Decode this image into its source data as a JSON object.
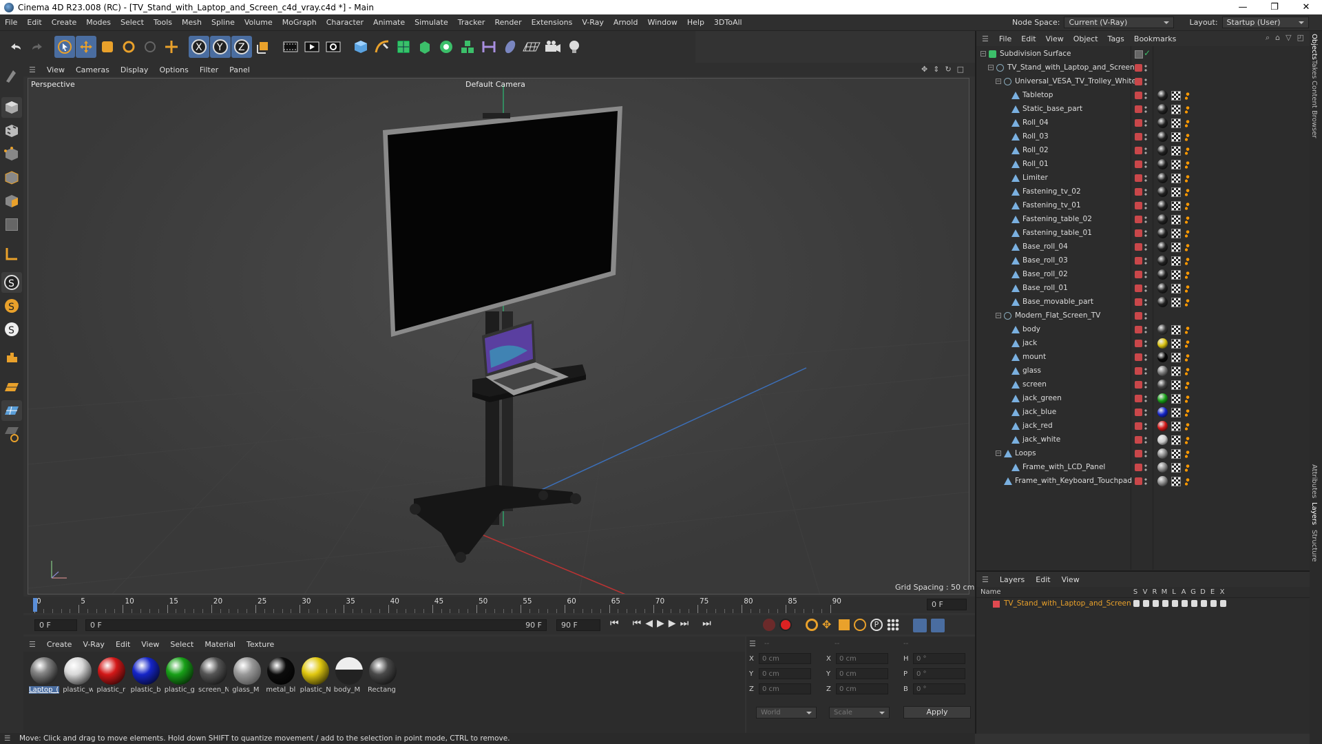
{
  "title": "Cinema 4D R23.008 (RC) - [TV_Stand_with_Laptop_and_Screen_c4d_vray.c4d *] - Main",
  "window_buttons": [
    "—",
    "❐",
    "✕"
  ],
  "menu": [
    "File",
    "Edit",
    "Create",
    "Modes",
    "Select",
    "Tools",
    "Mesh",
    "Spline",
    "Volume",
    "MoGraph",
    "Character",
    "Animate",
    "Simulate",
    "Tracker",
    "Render",
    "Extensions",
    "V-Ray",
    "Arnold",
    "Window",
    "Help",
    "3DToAll"
  ],
  "node_space": {
    "label": "Node Space:",
    "value": "Current (V-Ray)"
  },
  "layout": {
    "label": "Layout:",
    "value": "Startup (User)"
  },
  "viewport": {
    "menu": [
      "View",
      "Cameras",
      "Display",
      "Options",
      "Filter",
      "Panel"
    ],
    "view_name": "Perspective",
    "camera": "Default Camera",
    "grid_spacing": "Grid Spacing : 50 cm"
  },
  "timeline": {
    "ticks": [
      "0",
      "5",
      "10",
      "15",
      "20",
      "25",
      "30",
      "35",
      "40",
      "45",
      "50",
      "55",
      "60",
      "65",
      "70",
      "75",
      "80",
      "85",
      "90"
    ],
    "current_frame": "0 F",
    "start": "0 F",
    "range_start": "0 F",
    "range_end": "90 F",
    "end": "90 F"
  },
  "materials": {
    "menu": [
      "Create",
      "V-Ray",
      "Edit",
      "View",
      "Select",
      "Material",
      "Texture"
    ],
    "items": [
      {
        "name": "Laptop_(",
        "color": "#9aa",
        "style": "laptop"
      },
      {
        "name": "plastic_w",
        "color": "#d8d8d8",
        "style": "plain"
      },
      {
        "name": "plastic_r",
        "color": "#d31818",
        "style": "plain"
      },
      {
        "name": "plastic_b",
        "color": "#1525c8",
        "style": "plain"
      },
      {
        "name": "plastic_g",
        "color": "#18a018",
        "style": "plain"
      },
      {
        "name": "screen_N",
        "color": "#555",
        "style": "plain"
      },
      {
        "name": "glass_M",
        "color": "#888",
        "style": "glass"
      },
      {
        "name": "metal_bl",
        "color": "#0c0c0c",
        "style": "plain"
      },
      {
        "name": "plastic_N",
        "color": "#e0c810",
        "style": "plain"
      },
      {
        "name": "body_M",
        "color": "#333",
        "style": "body"
      },
      {
        "name": "Rectang",
        "color": "#4a4a4a",
        "style": "plain"
      }
    ]
  },
  "coords": {
    "headers": [
      "--",
      "--",
      "--"
    ],
    "rows": [
      {
        "a": "X",
        "av": "0 cm",
        "b": "X",
        "bv": "0 cm",
        "c": "H",
        "cv": "0 °"
      },
      {
        "a": "Y",
        "av": "0 cm",
        "b": "Y",
        "bv": "0 cm",
        "c": "P",
        "cv": "0 °"
      },
      {
        "a": "Z",
        "av": "0 cm",
        "b": "Z",
        "bv": "0 cm",
        "c": "B",
        "cv": "0 °"
      }
    ],
    "mode1": "World",
    "mode2": "Scale",
    "apply": "Apply"
  },
  "status": "Move: Click and drag to move elements. Hold down SHIFT to quantize movement / add to the selection in point mode, CTRL to remove.",
  "objects": {
    "menu": [
      "File",
      "Edit",
      "View",
      "Object",
      "Tags",
      "Bookmarks"
    ],
    "rows": [
      {
        "name": "Subdivision Surface",
        "indent": 0,
        "kind": "subd",
        "tags": "check"
      },
      {
        "name": "TV_Stand_with_Laptop_and_Screen",
        "indent": 1,
        "kind": "null",
        "tags": ""
      },
      {
        "name": "Universal_VESA_TV_Trolley_White",
        "indent": 2,
        "kind": "null",
        "tags": ""
      },
      {
        "name": "Tabletop",
        "indent": 3,
        "kind": "poly",
        "tags": "mat",
        "ball": "#222"
      },
      {
        "name": "Static_base_part",
        "indent": 3,
        "kind": "poly",
        "tags": "mat",
        "ball": "#222"
      },
      {
        "name": "Roll_04",
        "indent": 3,
        "kind": "poly",
        "tags": "mat",
        "ball": "#222"
      },
      {
        "name": "Roll_03",
        "indent": 3,
        "kind": "poly",
        "tags": "mat",
        "ball": "#222"
      },
      {
        "name": "Roll_02",
        "indent": 3,
        "kind": "poly",
        "tags": "mat",
        "ball": "#222"
      },
      {
        "name": "Roll_01",
        "indent": 3,
        "kind": "poly",
        "tags": "mat",
        "ball": "#222"
      },
      {
        "name": "Limiter",
        "indent": 3,
        "kind": "poly",
        "tags": "mat",
        "ball": "#222"
      },
      {
        "name": "Fastening_tv_02",
        "indent": 3,
        "kind": "poly",
        "tags": "mat",
        "ball": "#222"
      },
      {
        "name": "Fastening_tv_01",
        "indent": 3,
        "kind": "poly",
        "tags": "mat",
        "ball": "#222"
      },
      {
        "name": "Fastening_table_02",
        "indent": 3,
        "kind": "poly",
        "tags": "mat",
        "ball": "#222"
      },
      {
        "name": "Fastening_table_01",
        "indent": 3,
        "kind": "poly",
        "tags": "mat",
        "ball": "#222"
      },
      {
        "name": "Base_roll_04",
        "indent": 3,
        "kind": "poly",
        "tags": "mat",
        "ball": "#222"
      },
      {
        "name": "Base_roll_03",
        "indent": 3,
        "kind": "poly",
        "tags": "mat",
        "ball": "#222"
      },
      {
        "name": "Base_roll_02",
        "indent": 3,
        "kind": "poly",
        "tags": "mat",
        "ball": "#222"
      },
      {
        "name": "Base_roll_01",
        "indent": 3,
        "kind": "poly",
        "tags": "mat",
        "ball": "#222"
      },
      {
        "name": "Base_movable_part",
        "indent": 3,
        "kind": "poly",
        "tags": "mat",
        "ball": "#222"
      },
      {
        "name": "Modern_Flat_Screen_TV",
        "indent": 2,
        "kind": "null",
        "tags": ""
      },
      {
        "name": "body",
        "indent": 3,
        "kind": "poly",
        "tags": "mat",
        "ball": "#3a3a3a"
      },
      {
        "name": "jack",
        "indent": 3,
        "kind": "poly",
        "tags": "mat",
        "ball": "#d8c010"
      },
      {
        "name": "mount",
        "indent": 3,
        "kind": "poly",
        "tags": "mat",
        "ball": "#080808"
      },
      {
        "name": "glass",
        "indent": 3,
        "kind": "poly",
        "tags": "mat",
        "ball": "#777"
      },
      {
        "name": "screen",
        "indent": 3,
        "kind": "poly",
        "tags": "mat",
        "ball": "#444"
      },
      {
        "name": "jack_green",
        "indent": 3,
        "kind": "poly",
        "tags": "mat",
        "ball": "#18a018"
      },
      {
        "name": "jack_blue",
        "indent": 3,
        "kind": "poly",
        "tags": "mat",
        "ball": "#1525c8"
      },
      {
        "name": "jack_red",
        "indent": 3,
        "kind": "poly",
        "tags": "mat",
        "ball": "#d31818"
      },
      {
        "name": "jack_white",
        "indent": 3,
        "kind": "poly",
        "tags": "mat",
        "ball": "#ccc"
      },
      {
        "name": "Loops",
        "indent": 2,
        "kind": "poly",
        "tags": "mat",
        "ball": "#888"
      },
      {
        "name": "Frame_with_LCD_Panel",
        "indent": 3,
        "kind": "poly",
        "tags": "mat",
        "ball": "#888"
      },
      {
        "name": "Frame_with_Keyboard_Touchpad",
        "indent": 2,
        "kind": "poly",
        "tags": "mat",
        "ball": "#888"
      }
    ]
  },
  "layers": {
    "menu": [
      "Layers",
      "Edit",
      "View"
    ],
    "header_name": "Name",
    "header_flags": [
      "S",
      "V",
      "R",
      "M",
      "L",
      "A",
      "G",
      "D",
      "E",
      "X"
    ],
    "rows": [
      {
        "name": "TV_Stand_with_Laptop_and_Screen",
        "color": "#e04a50"
      }
    ]
  },
  "side_tabs": [
    "Objects",
    "Takes",
    "Content Browser",
    "Attributes",
    "Layers",
    "Structure"
  ]
}
